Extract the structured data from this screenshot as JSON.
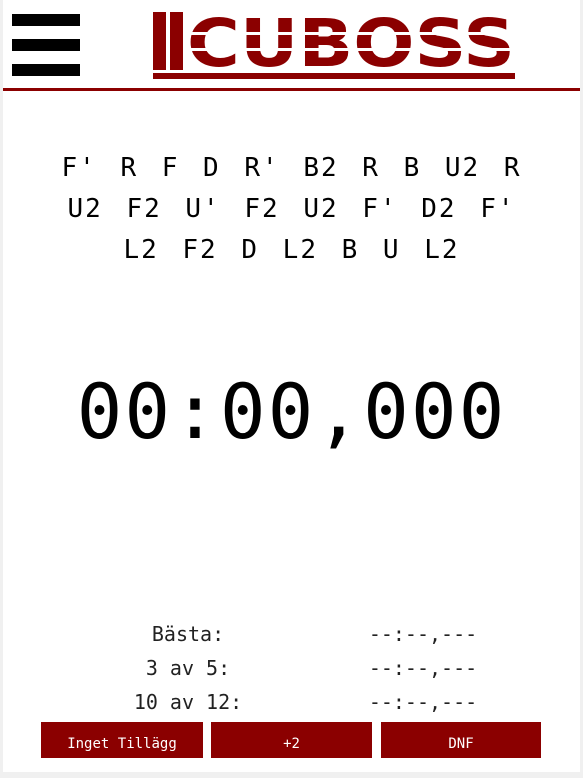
{
  "header": {
    "logo_text": "CUBOSS",
    "colors": {
      "brand": "#8b0000",
      "menu_icon": "#000000"
    },
    "menu_icon": "hamburger-menu-icon"
  },
  "scramble": {
    "lines": [
      "F' R F D R' B2 R B U2 R",
      "U2 F2 U' F2 U2 F' D2 F'",
      "L2 F2 D L2 B U L2"
    ]
  },
  "timer": {
    "display": "00:00,000"
  },
  "stats": [
    {
      "label": "Bästa:",
      "value": "--:--,---"
    },
    {
      "label": "3 av 5:",
      "value": "--:--,---"
    },
    {
      "label": "10 av 12:",
      "value": "--:--,---"
    }
  ],
  "penalty_buttons": {
    "none_label": "Inget Tillägg",
    "plus2_label": "+2",
    "dnf_label": "DNF"
  }
}
